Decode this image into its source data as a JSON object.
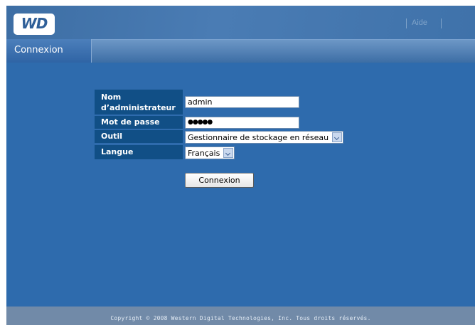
{
  "header": {
    "logo_text": "WD",
    "help_label": "Aide"
  },
  "tabs": [
    {
      "label": "Connexion"
    }
  ],
  "form": {
    "username_label": "Nom d’administrateur",
    "username_value": "admin",
    "password_label": "Mot de passe",
    "password_value": "●●●●●",
    "tool_label": "Outil",
    "tool_value": "Gestionnaire de stockage en réseau",
    "language_label": "Langue",
    "language_value": "Français",
    "submit_label": "Connexion"
  },
  "footer": {
    "copyright": "Copyright © 2008 Western Digital Technologies, Inc. Tous droits réservés."
  },
  "colors": {
    "header_bg": "#3d6ea4",
    "content_bg": "#2e6bad",
    "label_bg": "#114f86",
    "footer_bg": "#718aa8"
  }
}
